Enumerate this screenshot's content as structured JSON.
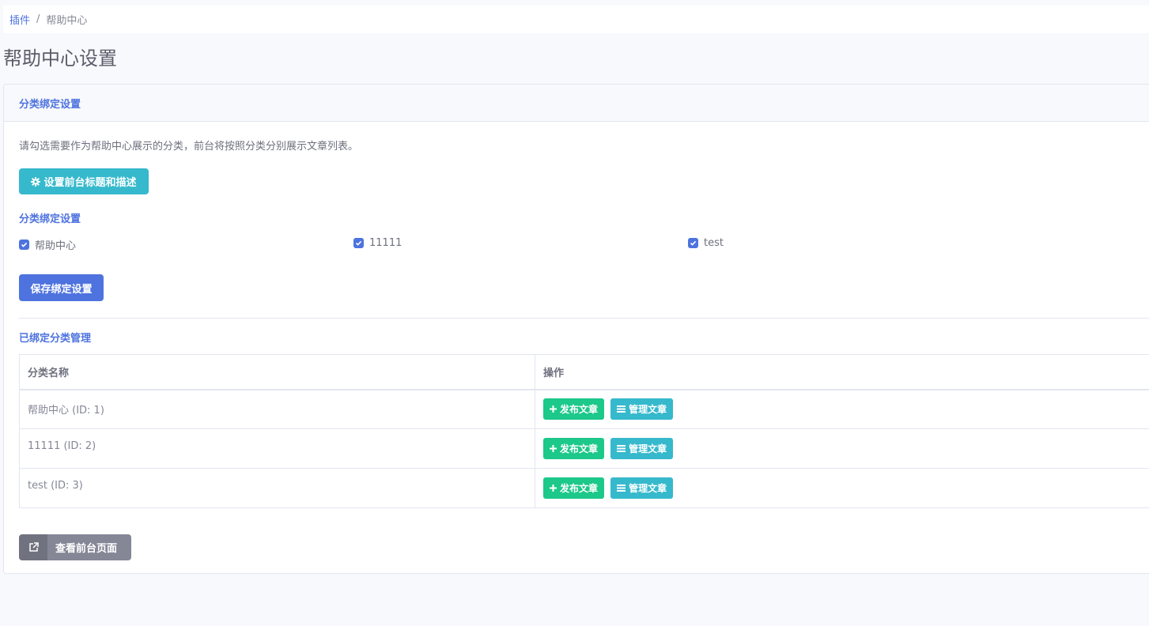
{
  "breadcrumb": {
    "root": "插件",
    "separator": "/",
    "current": "帮助中心"
  },
  "page_title": "帮助中心设置",
  "card": {
    "header": "分类绑定设置",
    "description": "请勾选需要作为帮助中心展示的分类，前台将按照分类分别展示文章列表。",
    "settings_button": "设置前台标题和描述",
    "binding_title": "分类绑定设置",
    "categories": [
      {
        "label": "帮助中心",
        "checked": true
      },
      {
        "label": "11111",
        "checked": true
      },
      {
        "label": "test",
        "checked": true
      }
    ],
    "save_button": "保存绑定设置",
    "manage_title": "已绑定分类管理",
    "table": {
      "headers": [
        "分类名称",
        "操作"
      ],
      "rows": [
        {
          "name": "帮助中心 (ID: 1)",
          "publish": "发布文章",
          "manage": "管理文章"
        },
        {
          "name": "11111 (ID: 2)",
          "publish": "发布文章",
          "manage": "管理文章"
        },
        {
          "name": "test (ID: 3)",
          "publish": "发布文章",
          "manage": "管理文章"
        }
      ]
    },
    "front_button": "查看前台页面"
  },
  "icons": {
    "settings": "gear-icon",
    "checkbox": "checkbox-checked-icon",
    "publish": "plus-icon",
    "manage": "list-icon",
    "front": "external-link-icon"
  },
  "colors": {
    "primary": "#4e73df",
    "info": "#36b9cc",
    "success": "#1cc88a",
    "secondary": "#858796"
  }
}
